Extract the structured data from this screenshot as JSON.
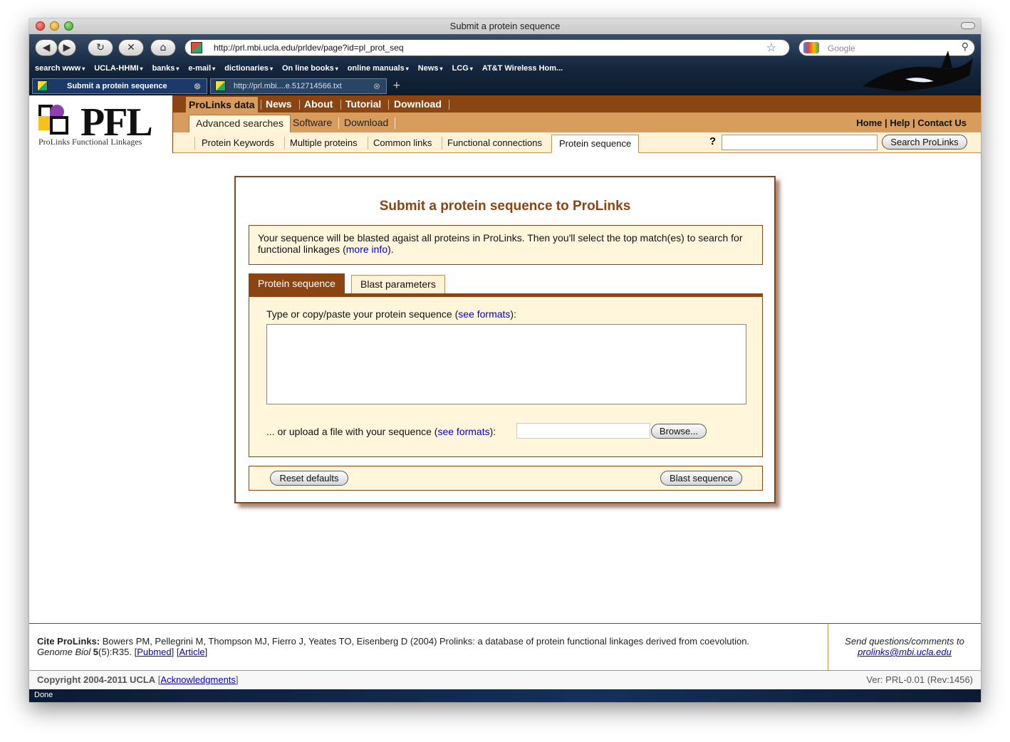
{
  "window": {
    "title": "Submit a protein sequence"
  },
  "toolbar": {
    "back": "◀",
    "forward": "▶",
    "reload": "↻",
    "stop": "✕",
    "home": "⌂",
    "url": "http://prl.mbi.ucla.edu/prldev/page?id=pl_prot_seq",
    "search_placeholder": "Google"
  },
  "bookmarks": [
    "search www",
    "UCLA-HHMI",
    "banks",
    "e-mail",
    "dictionaries",
    "On line books",
    "online manuals",
    "News",
    "LCG",
    "AT&T Wireless Hom..."
  ],
  "browser_tabs": [
    {
      "label": "Submit a protein sequence",
      "active": true
    },
    {
      "label": "http://prl.mbi....e.512714566.txt",
      "active": false
    }
  ],
  "site": {
    "logo": "PFL",
    "logo_subtitle": "ProLinks Functional Linkages",
    "nav1": [
      "ProLinks data",
      "News",
      "About",
      "Tutorial",
      "Download"
    ],
    "nav2": [
      "Advanced searches",
      "Software",
      "Download"
    ],
    "nav2_right": {
      "home": "Home",
      "help": "Help",
      "contact": "Contact Us",
      "sep": "|"
    },
    "nav3": [
      "Protein Keywords",
      "Multiple proteins",
      "Common links",
      "Functional connections",
      "Protein sequence"
    ],
    "help_mark": "?",
    "search_button": "Search ProLinks"
  },
  "panel": {
    "title": "Submit a protein sequence to ProLinks",
    "info_text": "Your sequence will be blasted agaist all proteins in ProLinks. Then you'll select the top match(es) to search for functional linkages (",
    "info_link": "more info",
    "info_end": ").",
    "tabs": [
      "Protein sequence",
      "Blast parameters"
    ],
    "sequence_label": "Type or copy/paste your protein sequence (",
    "see_formats": "see formats",
    "label_close": "):",
    "upload_label": "... or upload a file with your sequence (",
    "browse_button": "Browse...",
    "reset_button": "Reset defaults",
    "blast_button": "Blast sequence"
  },
  "footer": {
    "cite_label": "Cite ProLinks:",
    "cite_text": "Bowers PM, Pellegrini M, Thompson MJ, Fierro J, Yeates TO, Eisenberg D (2004) Prolinks: a database of protein functional linkages derived from coevolution.",
    "journal": "Genome Biol",
    "volume": "5",
    "issue": "(5):R35.",
    "pubmed": "Pubmed",
    "article": "Article",
    "contact_text": "Send questions/comments to",
    "contact_email": "prolinks@mbi.ucla.edu",
    "copyright": "Copyright 2004-2011 UCLA",
    "acknowledgments": "Acknowledgments",
    "version": "Ver: PRL-0.01 (Rev:1456)"
  },
  "status": "Done"
}
